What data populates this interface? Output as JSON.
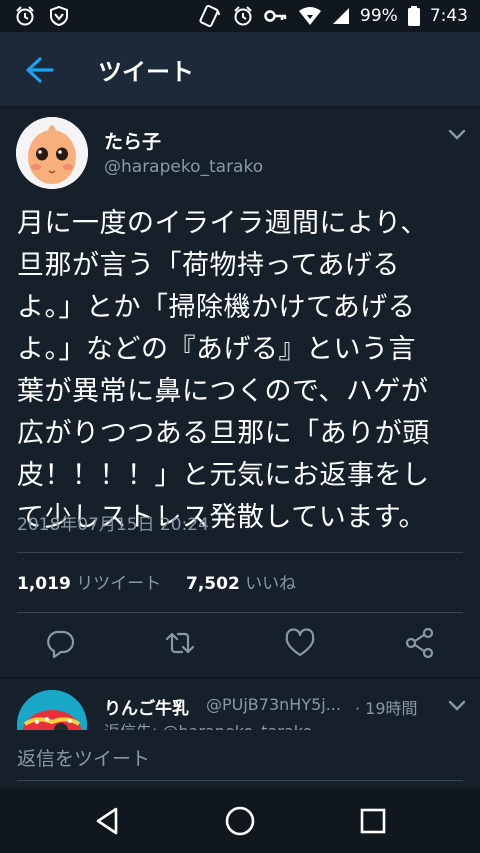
{
  "status_bar": {
    "battery": "99%",
    "time": "7:43"
  },
  "header": {
    "title": "ツイート"
  },
  "tweet": {
    "name": "たら子",
    "handle": "@harapeko_tarako",
    "text_lines": [
      "月に一度のイライラ週間により、",
      "旦那が言う「荷物持ってあげる",
      "よ。」とか「掃除機かけてあげる",
      "よ。」などの『あげる』という言",
      "葉が異常に鼻につくので、ハゲが",
      "広がりつつある旦那に「ありが頭",
      "皮！！！！」と元気にお返事をし",
      "て少しストレス発散しています。"
    ],
    "timestamp": "2018年07月15日 20:24",
    "retweets_count": "1,019",
    "retweets_label": "リツイート",
    "likes_count": "7,502",
    "likes_label": "いいね"
  },
  "reply": {
    "name": "りんご牛乳",
    "handle": "@PUjB73nHY5j...",
    "time": "· 19時間",
    "peek": "返信先: @harapeko_tarako"
  },
  "composer": {
    "placeholder": "返信をツイート"
  },
  "colors": {
    "background": "#15202b",
    "header": "#1c2938",
    "accent": "#1da1f2",
    "secondary_text": "#8899a6"
  },
  "icons": [
    "alarm-icon",
    "shield-icon",
    "nfc-icon",
    "key-icon",
    "wifi-icon",
    "signal-icon",
    "battery-icon",
    "back-arrow-icon",
    "chevron-down-icon",
    "reply-icon",
    "retweet-icon",
    "like-icon",
    "share-icon",
    "nav-back-icon",
    "nav-home-icon",
    "nav-recents-icon"
  ]
}
